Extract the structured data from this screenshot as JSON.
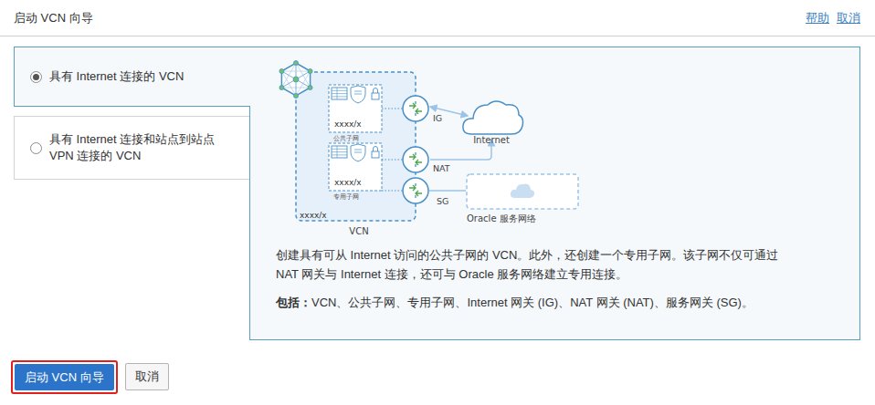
{
  "header": {
    "title": "启动 VCN 向导",
    "links": [
      "帮助",
      "取消"
    ]
  },
  "options": [
    {
      "lines": [
        "具有 Internet 连接的 VCN"
      ],
      "selected": true
    },
    {
      "lines": [
        "具有 Internet 连接和站点到站点",
        "VPN 连接的 VCN"
      ],
      "selected": false
    }
  ],
  "diagram": {
    "subnets": [
      {
        "label": "公共子网",
        "cidr": "xxxx/x"
      },
      {
        "label": "专用子网",
        "cidr": "xxxx/x"
      }
    ],
    "vcn_cidr": "xxxx/x",
    "vcn_label": "VCN",
    "gateways": [
      "IG",
      "NAT",
      "SG"
    ],
    "internet": "Internet",
    "oracle": "Oracle 服务网络"
  },
  "description": [
    "创建具有可从 Internet 访问的公共子网的 VCN。此外，还创建一个专用子网。该子网不仅可通过",
    "NAT 网关与 Internet 连接，还可与 Oracle 服务网络建立专用连接。"
  ],
  "includes": {
    "label": "包括：",
    "text": "VCN、公共子网、专用子网、Internet 网关 (IG)、NAT 网关 (NAT)、服务网关 (SG)。"
  },
  "buttons": [
    {
      "label": "启动 VCN 向导",
      "highlighted": true
    },
    {
      "label": "取消",
      "highlighted": false
    }
  ]
}
